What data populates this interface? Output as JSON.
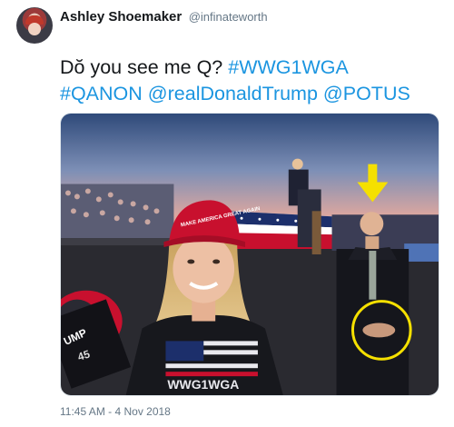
{
  "author": {
    "display_name": "Ashley Shoemaker",
    "handle": "@infinateworth"
  },
  "tweet": {
    "text_prefix": "Dŏ you see me Q? ",
    "tags_line1": [
      "#WWG1WGA"
    ],
    "tags_line2": [
      "#QANON",
      "@realDonaldTrump",
      "@POTUS"
    ]
  },
  "media": {
    "hat_text": "MAKE AMERICA GREAT AGAIN",
    "shirt_text": "WWG1WGA",
    "mic_text": "UMP",
    "mic_number": "45"
  },
  "timestamp": "11:45 AM - 4 Nov 2018",
  "colors": {
    "link": "#1b95e0",
    "arrow": "#f5e000",
    "circle": "#f5e000",
    "hat": "#c8102e"
  }
}
